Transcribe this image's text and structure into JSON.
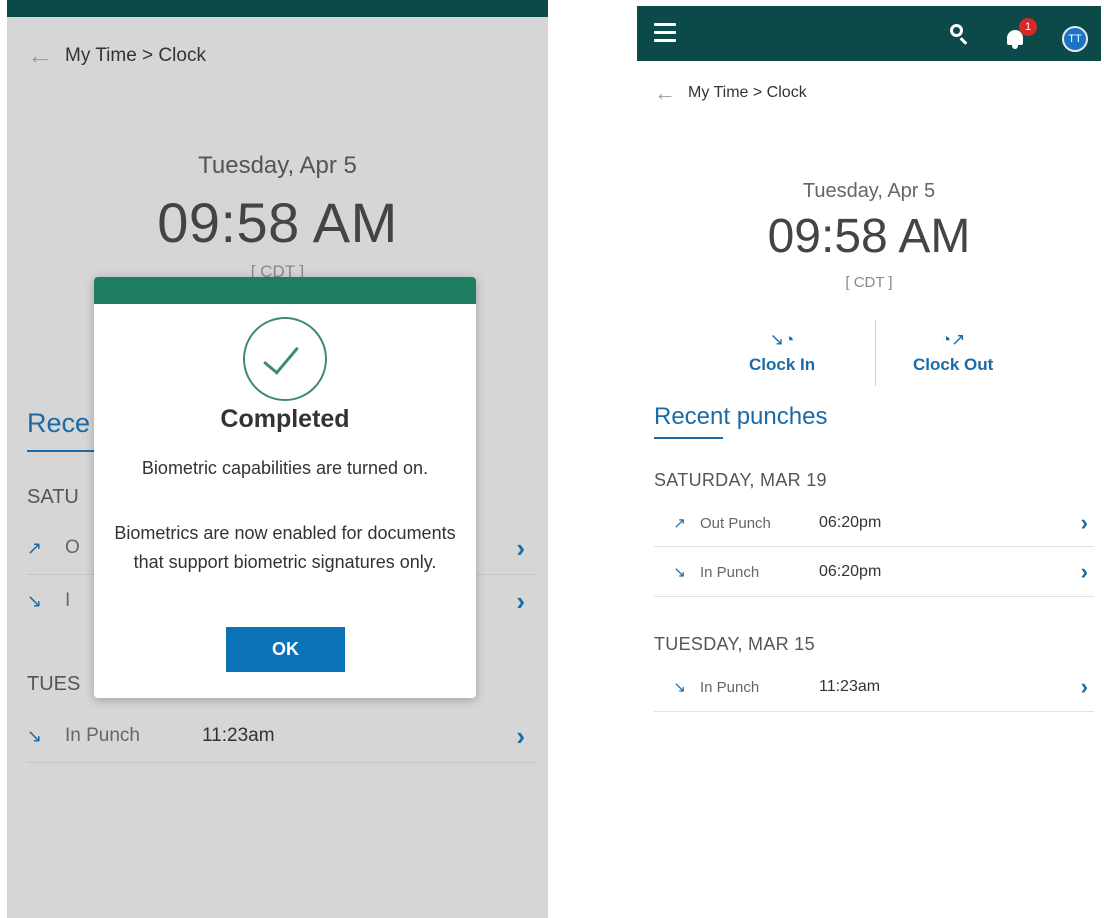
{
  "breadcrumb": {
    "back_icon": "arrow-left-icon",
    "text": "My Time > Clock"
  },
  "clock": {
    "date": "Tuesday, Apr 5",
    "time": "09:58 AM",
    "timezone": "[ CDT ]"
  },
  "actions": {
    "clock_in": {
      "label": "Clock In",
      "icon": "clock-in-icon"
    },
    "clock_out": {
      "label": "Clock Out",
      "icon": "clock-out-icon"
    }
  },
  "recent": {
    "title": "Recent punches",
    "title_truncated": "Rece",
    "days": [
      {
        "label": "SATURDAY, MAR 19",
        "label_truncated": "SATU",
        "punches": [
          {
            "type": "Out Punch",
            "type_truncated": "O",
            "time": "06:20pm",
            "icon": "clock-out-icon"
          },
          {
            "type": "In Punch",
            "type_truncated": "I",
            "time": "06:20pm",
            "icon": "clock-in-icon"
          }
        ]
      },
      {
        "label": "TUESDAY, MAR 15",
        "label_truncated": "TUES",
        "punches": [
          {
            "type": "In Punch",
            "time": "11:23am",
            "icon": "clock-in-icon"
          }
        ]
      }
    ]
  },
  "modal": {
    "title": "Completed",
    "icon": "checkmark-circle-icon",
    "message1": "Biometric capabilities are turned on.",
    "message2": "Biometrics are now enabled for documents that support biometric signatures only.",
    "ok_label": "OK"
  },
  "header": {
    "menu_icon": "hamburger-menu-icon",
    "search_icon": "search-icon",
    "bell_icon": "bell-icon",
    "notification_count": "1",
    "avatar_initials": "TT"
  },
  "colors": {
    "header_bg": "#0b4a48",
    "accent_blue": "#1a6ba6",
    "modal_header": "#1f7d62",
    "ok_button": "#0a73b7",
    "badge_red": "#d62828"
  }
}
